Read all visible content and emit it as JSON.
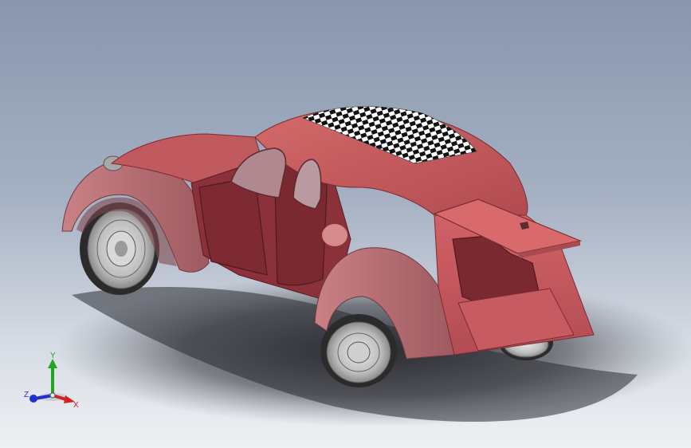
{
  "viewport": {
    "background_top": "#8896ad",
    "background_bottom": "#eef0f3",
    "model_color": "#c4575a",
    "model_dark": "#7a2c33",
    "shadow_color": "#2e2f36"
  },
  "triad": {
    "x_label": "X",
    "y_label": "Y",
    "z_label": "Z",
    "x_color": "#d42020",
    "y_color": "#1fa81f",
    "z_color": "#1f2fcf"
  }
}
